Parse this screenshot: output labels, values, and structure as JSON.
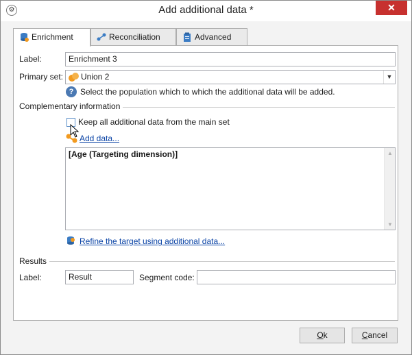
{
  "window": {
    "title": "Add additional data *",
    "close_glyph": "✕",
    "app_icon": "gear-app-icon"
  },
  "tabs": [
    {
      "label": "Enrichment",
      "icon": "database-icon",
      "active": true
    },
    {
      "label": "Reconciliation",
      "icon": "link-nodes-icon",
      "active": false
    },
    {
      "label": "Advanced",
      "icon": "clipboard-icon",
      "active": false
    }
  ],
  "form": {
    "label_caption": "Label:",
    "label_value": "Enrichment 3",
    "primary_set_caption": "Primary set:",
    "primary_set_value": "Union 2",
    "primary_set_icon": "union-circles-icon",
    "help_text": "Select the population which to which the additional data will be added.",
    "help_glyph": "?"
  },
  "complementary": {
    "section_title": "Complementary information",
    "keep_all_label": "Keep all additional data from the main set",
    "keep_all_checked": false,
    "add_data_link": "Add data...",
    "list_items": [
      "[Age (Targeting dimension)]"
    ],
    "refine_link": "Refine the target using additional data..."
  },
  "results": {
    "section_title": "Results",
    "label_caption": "Label:",
    "label_value": "Result",
    "segment_caption": "Segment code:",
    "segment_value": ""
  },
  "buttons": {
    "ok_first": "O",
    "ok_rest": "k",
    "cancel_first": "C",
    "cancel_rest": "ancel"
  }
}
